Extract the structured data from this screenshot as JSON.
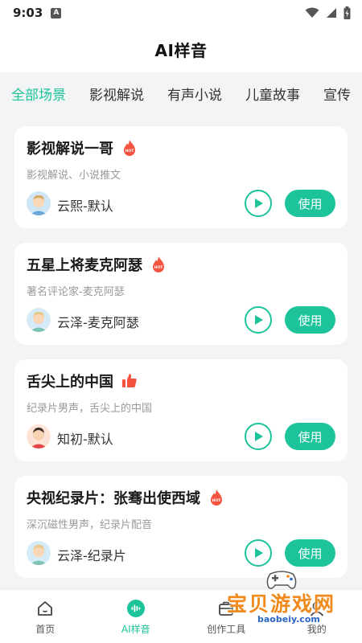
{
  "status_bar": {
    "time": "9:03",
    "notification_icon": "A",
    "icons": [
      "wifi-icon",
      "signal-icon",
      "battery-icon"
    ]
  },
  "header": {
    "title": "AI样音"
  },
  "tabs": [
    {
      "label": "全部场景",
      "active": true
    },
    {
      "label": "影视解说",
      "active": false
    },
    {
      "label": "有声小说",
      "active": false
    },
    {
      "label": "儿童故事",
      "active": false
    },
    {
      "label": "宣传",
      "active": false
    }
  ],
  "cards": [
    {
      "title": "影视解说一哥",
      "badge": "hot",
      "description": "影视解说、小说推文",
      "voice": "云熙-默认",
      "use_label": "使用"
    },
    {
      "title": "五星上将麦克阿瑟",
      "badge": "hot",
      "description": "著名评论家-麦克阿瑟",
      "voice": "云泽-麦克阿瑟",
      "use_label": "使用"
    },
    {
      "title": "舌尖上的中国",
      "badge": "thumbs-up",
      "description": "纪录片男声，舌尖上的中国",
      "voice": "知初-默认",
      "use_label": "使用"
    },
    {
      "title": "央视纪录片：张骞出使西域",
      "badge": "hot",
      "description": "深沉磁性男声，纪录片配音",
      "voice": "云泽-纪录片",
      "use_label": "使用"
    }
  ],
  "bottom_nav": [
    {
      "label": "首页",
      "icon": "home-icon",
      "active": false
    },
    {
      "label": "AI样音",
      "icon": "voice-wave-icon",
      "active": true
    },
    {
      "label": "创作工具",
      "icon": "toolbox-icon",
      "active": false
    },
    {
      "label": "我的",
      "icon": "profile-icon",
      "active": false
    }
  ],
  "watermark": {
    "text": "宝贝游戏网",
    "url": "baobeiy.com"
  },
  "colors": {
    "accent": "#1cc39b",
    "hot_badge": "#f4533f",
    "background": "#f3f4f6"
  }
}
